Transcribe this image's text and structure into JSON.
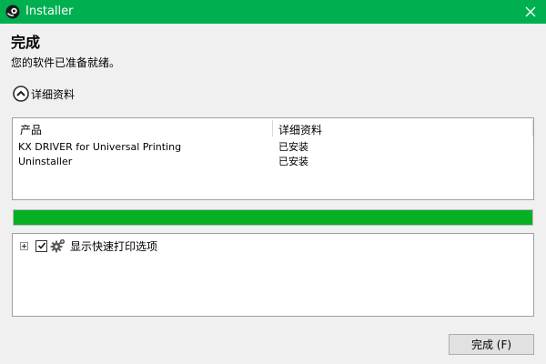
{
  "window": {
    "title": "Installer",
    "accent_color": "#00b050",
    "close_icon": "close-icon",
    "app_icon": "installer-app-icon"
  },
  "header": {
    "title": "完成",
    "subtitle": "您的软件已准备就绪。"
  },
  "details_toggle": {
    "label": "详细资料",
    "icon": "chevron-up-circle-icon"
  },
  "details_table": {
    "columns": [
      "产品",
      "详细资料"
    ],
    "rows": [
      [
        "KX DRIVER for Universal Printing",
        "已安装"
      ],
      [
        "Uninstaller",
        "已安装"
      ]
    ]
  },
  "progress": {
    "percent": 100,
    "color": "#06b025"
  },
  "options": {
    "items": [
      {
        "label": "显示快速打印选项",
        "checked": true,
        "expandable": true,
        "icon": "gear-icon"
      }
    ]
  },
  "footer": {
    "finish_label": "完成 (F)"
  }
}
